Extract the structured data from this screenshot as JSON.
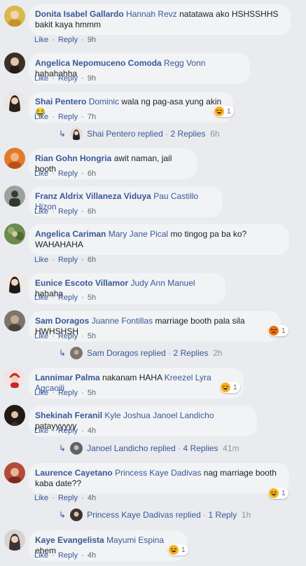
{
  "meta": {
    "like": "Like",
    "reply": "Reply",
    "sep": "·"
  },
  "colors": {
    "link": "#385898",
    "bubble": "#f2f3f5",
    "background": "#e9ebee",
    "haha": "#f7b125",
    "angry": "#e9710f"
  },
  "comments": [
    {
      "name": "Donita Isabel Gallardo",
      "mention": "Hannah Revz",
      "text": "natatawa ako HSHSSHHS bakit kaya hmmm",
      "time": "9h",
      "avatar": "avatar-donita"
    },
    {
      "name": "Angelica Nepomuceno Comoda",
      "mention": "Regg Vonn",
      "text": "hahahahha",
      "time": "9h",
      "avatar": "avatar-angelica-n"
    },
    {
      "name": "Shai Pentero",
      "mention": "Dominic",
      "text": "wala ng pag-asa yung akin😂",
      "time": "7h",
      "reaction": {
        "icon": "haha-icon",
        "count": "1"
      },
      "replies": {
        "user": "Shai Pentero",
        "label": "replied",
        "count": "2 Replies",
        "time": "6h"
      }
    },
    {
      "name": "Rian Gohn Hongria",
      "mention": "",
      "text": "awit naman, jail booth",
      "time": "6h"
    },
    {
      "name": "Franz Aldrix Villaneza Viduya",
      "mention": "Pau Castillo Hizon",
      "text": "",
      "time": "6h"
    },
    {
      "name": "Angelica Cariman",
      "mention": "Mary Jane Pical",
      "text": "mo tingog pa ba ko? WAHAHAHA",
      "time": "6h"
    },
    {
      "name": "Eunice Escoto Villamor",
      "mention": "Judy Ann Manuel",
      "text": "hahaha",
      "time": "5h"
    },
    {
      "name": "Sam Doragos",
      "mention": "Juanne Fontillas",
      "text": "marriage booth pala sila HWHSHSH",
      "time": "5h",
      "reaction": {
        "icon": "angry-icon",
        "count": "1"
      },
      "replies": {
        "user": "Sam Doragos",
        "label": "replied",
        "count": "2 Replies",
        "time": "2h"
      }
    },
    {
      "name": "Lannimar Palma",
      "mention": "",
      "text": "nakanam HAHA",
      "mention2": "Kreezel Lyra Agcaoili",
      "time": "5h",
      "reaction": {
        "icon": "haha-icon",
        "count": "1"
      }
    },
    {
      "name": "Shekinah Feranil",
      "mention": "Kyle Joshua Janoel Landicho",
      "text": "patayyyyyy",
      "time": "4h",
      "replies": {
        "user": "Janoel Landicho",
        "label": "replied",
        "count": "4 Replies",
        "time": "41m"
      }
    },
    {
      "name": "Laurence Cayetano",
      "mention": "Princess Kaye Dadivas",
      "text": "nag marriage booth kaba date??",
      "time": "4h",
      "reaction": {
        "icon": "haha-icon",
        "count": "1"
      },
      "replies": {
        "user": "Princess Kaye Dadivas",
        "label": "replied",
        "count": "1 Reply",
        "time": "1h"
      }
    },
    {
      "name": "Kaye Evangelista",
      "mention": "Mayumi Espina",
      "text": "ehem",
      "time": "4h",
      "reaction": {
        "icon": "haha-icon",
        "count": "1"
      }
    }
  ]
}
